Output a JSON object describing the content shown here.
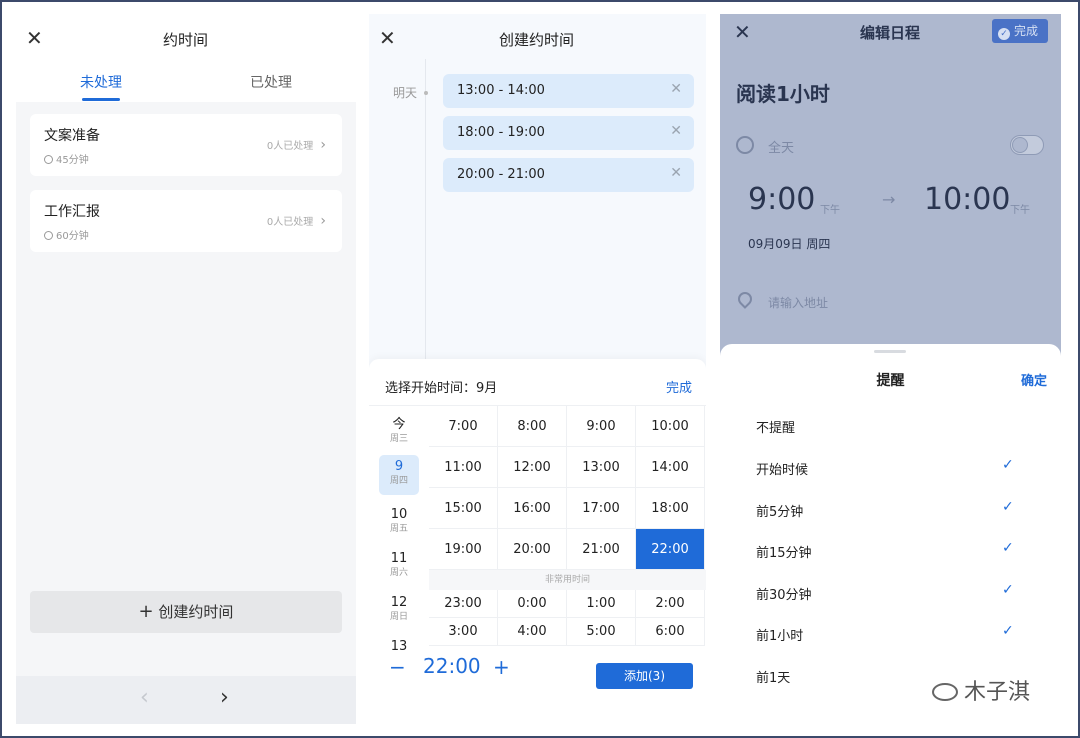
{
  "panel1": {
    "close_icon": "✕",
    "title": "约时间",
    "tabs": [
      "未处理",
      "已处理"
    ],
    "items": [
      {
        "title": "文案准备",
        "duration": "45分钟",
        "status": "0人已处理"
      },
      {
        "title": "工作汇报",
        "duration": "60分钟",
        "status": "0人已处理"
      }
    ],
    "create_label": "创建约时间",
    "create_icon": "+",
    "prev_icon": "‹",
    "next_icon": "›"
  },
  "panel2": {
    "close_icon": "✕",
    "title": "创建约时间",
    "day_label": "明天",
    "slots": [
      "13:00 - 14:00",
      "18:00 - 19:00",
      "20:00 - 21:00"
    ],
    "slot_remove_icon": "✕",
    "sheet_header": "选择开始时间：9月",
    "done_label": "完成",
    "days": [
      {
        "num": "今",
        "week": "周三"
      },
      {
        "num": "9",
        "week": "周四",
        "selected": true
      },
      {
        "num": "10",
        "week": "周五"
      },
      {
        "num": "11",
        "week": "周六"
      },
      {
        "num": "12",
        "week": "周日"
      },
      {
        "num": "13",
        "week": ""
      }
    ],
    "times": [
      "7:00",
      "8:00",
      "9:00",
      "10:00",
      "11:00",
      "12:00",
      "13:00",
      "14:00",
      "15:00",
      "16:00",
      "17:00",
      "18:00",
      "19:00",
      "20:00",
      "21:00",
      "22:00"
    ],
    "selected_time": "22:00",
    "rare_label": "非常用时间",
    "rare_times": [
      "23:00",
      "0:00",
      "1:00",
      "2:00",
      "3:00",
      "4:00",
      "5:00",
      "6:00"
    ],
    "minus_icon": "−",
    "plus_icon": "+",
    "current_time": "22:00",
    "add_label": "添加(3)"
  },
  "panel3": {
    "close_icon": "✕",
    "title": "编辑日程",
    "done_label": "完成",
    "event_title": "阅读1小时",
    "allday_label": "全天",
    "start_time": "9:00",
    "start_ampm": "下午",
    "end_time": "10:00",
    "end_ampm": "下午",
    "date": "09月09日 周四",
    "address_placeholder": "请输入地址",
    "sheet_title": "提醒",
    "confirm_label": "确定",
    "options": [
      {
        "label": "不提醒",
        "checked": false
      },
      {
        "label": "开始时候",
        "checked": true
      },
      {
        "label": "前5分钟",
        "checked": true
      },
      {
        "label": "前15分钟",
        "checked": true
      },
      {
        "label": "前30分钟",
        "checked": true
      },
      {
        "label": "前1小时",
        "checked": true
      },
      {
        "label": "前1天",
        "checked": false
      }
    ],
    "check_icon": "✓"
  },
  "watermark": "木子淇",
  "colors": {
    "accent": "#1f6bd8",
    "slot_bg": "#dcebfb",
    "overlay": "#aeb8cf"
  }
}
